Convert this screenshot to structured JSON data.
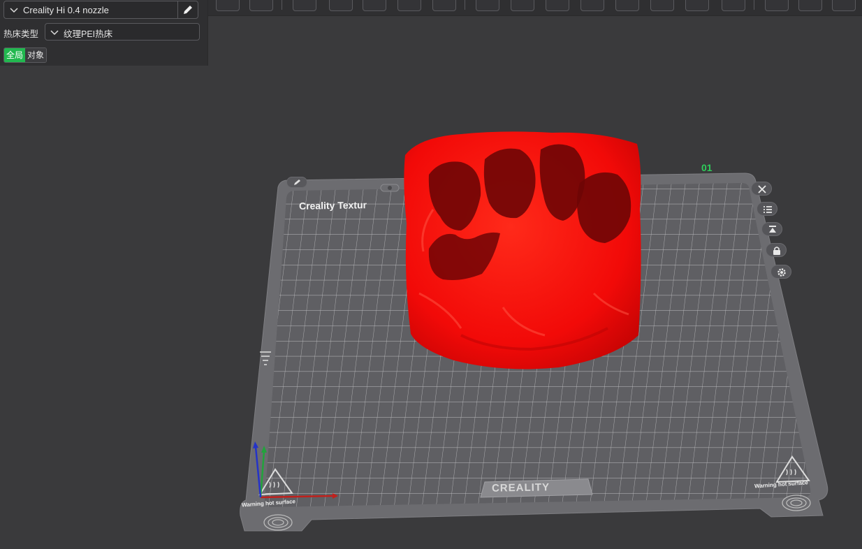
{
  "panel": {
    "printer_select": {
      "value": "Creality Hi 0.4 nozzle",
      "chevron_icon": "chevron-down-icon",
      "edit_icon": "pencil-icon"
    },
    "bed_type": {
      "label": "热床类型",
      "value": "纹理PEI热床"
    },
    "scope_toggle": {
      "global": "全局",
      "object": "对象",
      "active": "global"
    }
  },
  "toolbar": {
    "icons": [
      "add-object-icon",
      "layout-icon",
      "orient-icon",
      "arrange-icon",
      "lay-on-face-icon",
      "split-icon",
      "plate-icon",
      "move-icon",
      "rotate-icon",
      "scale-icon",
      "cut-icon",
      "support-paint-icon",
      "seam-paint-icon",
      "mesh-boolean-icon",
      "measure-icon",
      "text-icon",
      "hollow-icon",
      "drill-icon",
      "more-icon"
    ]
  },
  "scene": {
    "bed_label": "Creality Textur",
    "brand": "CREALITY",
    "warning_left": "Warning hot surface",
    "warning_right": "Warning hot surface",
    "plate_number": "01",
    "model_color": "#ff0a0a",
    "axis_colors": {
      "x": "#c0201c",
      "y": "#22a33c",
      "z": "#2433c8"
    }
  },
  "side_buttons": [
    "close-icon",
    "list-icon",
    "auto-orient-icon",
    "lock-icon",
    "settings-icon"
  ],
  "colors": {
    "background": "#3a3a3c",
    "panel": "#2f2f31",
    "accent": "#21b84f"
  }
}
